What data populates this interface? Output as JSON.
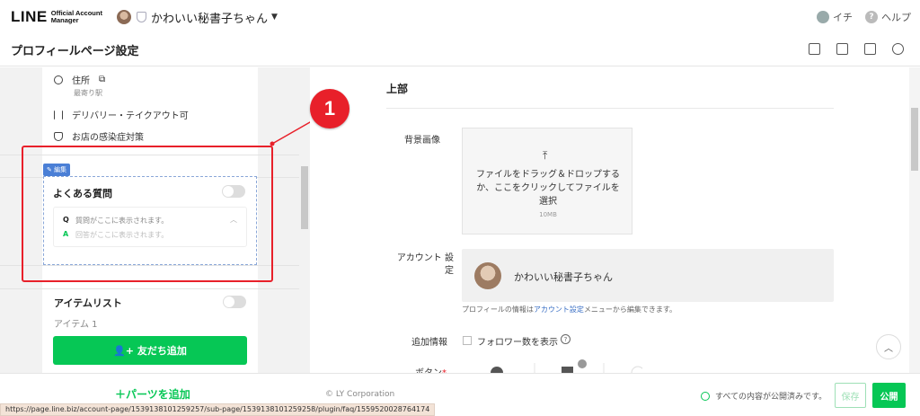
{
  "header": {
    "logo_main": "LINE",
    "logo_sub_1": "Official Account",
    "logo_sub_2": "Manager",
    "account_name": "かわいい秘書子ちゃん",
    "user_label": "イチ",
    "help_label": "ヘルプ"
  },
  "page": {
    "title": "プロフィールページ設定"
  },
  "preview": {
    "address_label": "住所",
    "address_sub": "最寄り駅",
    "delivery_label": "デリバリー・テイクアウト可",
    "covid_label": "お店の感染症対策",
    "edit_badge": "編集",
    "faq": {
      "title": "よくある質問",
      "q_mark": "Q",
      "q_text": "質問がここに表示されます。",
      "a_mark": "A",
      "a_text": "回答がここに表示されます。"
    },
    "item_list_title": "アイテムリスト",
    "item_list_sub": "アイテム 1",
    "add_friend_label": "友だち追加"
  },
  "callout_number": "1",
  "settings": {
    "section_title": "上部",
    "background_label": "背景画像",
    "upload_text": "ファイルをドラッグ＆ドロップするか、ここをクリックしてファイルを選択",
    "upload_size": "10MB",
    "account_label": "アカウント 設定",
    "account_name": "かわいい秘書子ちゃん",
    "note_before": "プロフィールの情報は",
    "note_link": "アカウント設定",
    "note_after": "メニューから編集できます。",
    "extra_label": "追加情報",
    "follower_label": "フォロワー数を表示",
    "button_label": "ボタン",
    "required_mark": "*"
  },
  "footer": {
    "add_parts_label": "＋パーツを追加",
    "copyright": "© LY Corporation",
    "status_text": "すべての内容が公開済みです。",
    "save_label": "保存",
    "publish_label": "公開"
  },
  "status_url": "https://page.line.biz/account-page/1539138101259257/sub-page/1539138101259258/plugin/faq/1559520028764174",
  "colors": {
    "line_green": "#06c755",
    "callout_red": "#e8202a",
    "link_blue": "#3a6fc4"
  }
}
